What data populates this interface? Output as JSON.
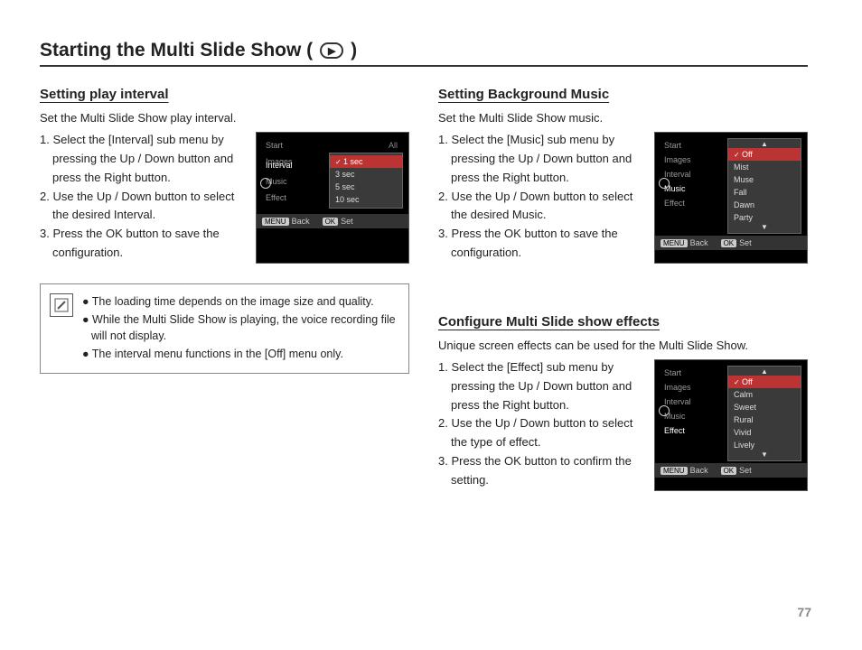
{
  "page": {
    "title_pre": "Starting the Multi Slide Show (",
    "title_post": ")",
    "slide_icon_glyph": "▶",
    "number": "77"
  },
  "left": {
    "section1": {
      "title": "Setting play interval",
      "intro": "Set the Multi Slide Show play interval.",
      "steps": [
        "1. Select the [Interval] sub menu by",
        "pressing the Up / Down button and",
        "press the Right button.",
        "2. Use the Up / Down button to select",
        "the desired Interval.",
        "3. Press the OK button to save the",
        "configuration."
      ],
      "menu": {
        "items": [
          "Start",
          "Images",
          "Interval",
          "Music",
          "Effect"
        ],
        "active": "Interval",
        "right_label": "All",
        "sub": [
          "1 sec",
          "3 sec",
          "5 sec",
          "10 sec"
        ],
        "selected": "1 sec",
        "back": "Back",
        "set": "Set",
        "menu_tag": "MENU",
        "ok_tag": "OK"
      }
    },
    "notes": [
      "● The loading time depends on the image size and quality.",
      "● While the Multi Slide Show is playing, the voice recording file will not display.",
      "● The interval menu functions in the [Off] menu only."
    ]
  },
  "right": {
    "section1": {
      "title": "Setting Background Music",
      "intro": "Set the Multi Slide Show music.",
      "steps": [
        "1. Select the [Music] sub menu by",
        "pressing the Up / Down button and",
        "press the Right button.",
        "2. Use the Up / Down button to select",
        "the desired Music.",
        "3. Press the OK button to save the",
        "configuration."
      ],
      "menu": {
        "items": [
          "Start",
          "Images",
          "Interval",
          "Music",
          "Effect"
        ],
        "active": "Music",
        "sub": [
          "Off",
          "Mist",
          "Muse",
          "Fall",
          "Dawn",
          "Party"
        ],
        "selected": "Off",
        "back": "Back",
        "set": "Set",
        "menu_tag": "MENU",
        "ok_tag": "OK"
      }
    },
    "section2": {
      "title": "Configure Multi Slide show effects",
      "intro": "Unique screen effects can be used for the Multi Slide Show.",
      "steps": [
        "1. Select the [Effect] sub menu by",
        "pressing the Up / Down button and",
        "press the Right button.",
        "2. Use the Up / Down button to select",
        "the type of effect.",
        "3. Press the OK button to confirm the",
        "setting."
      ],
      "menu": {
        "items": [
          "Start",
          "Images",
          "Interval",
          "Music",
          "Effect"
        ],
        "active": "Effect",
        "sub": [
          "Off",
          "Calm",
          "Sweet",
          "Rural",
          "Vivid",
          "Lively"
        ],
        "selected": "Off",
        "back": "Back",
        "set": "Set",
        "menu_tag": "MENU",
        "ok_tag": "OK"
      }
    }
  }
}
